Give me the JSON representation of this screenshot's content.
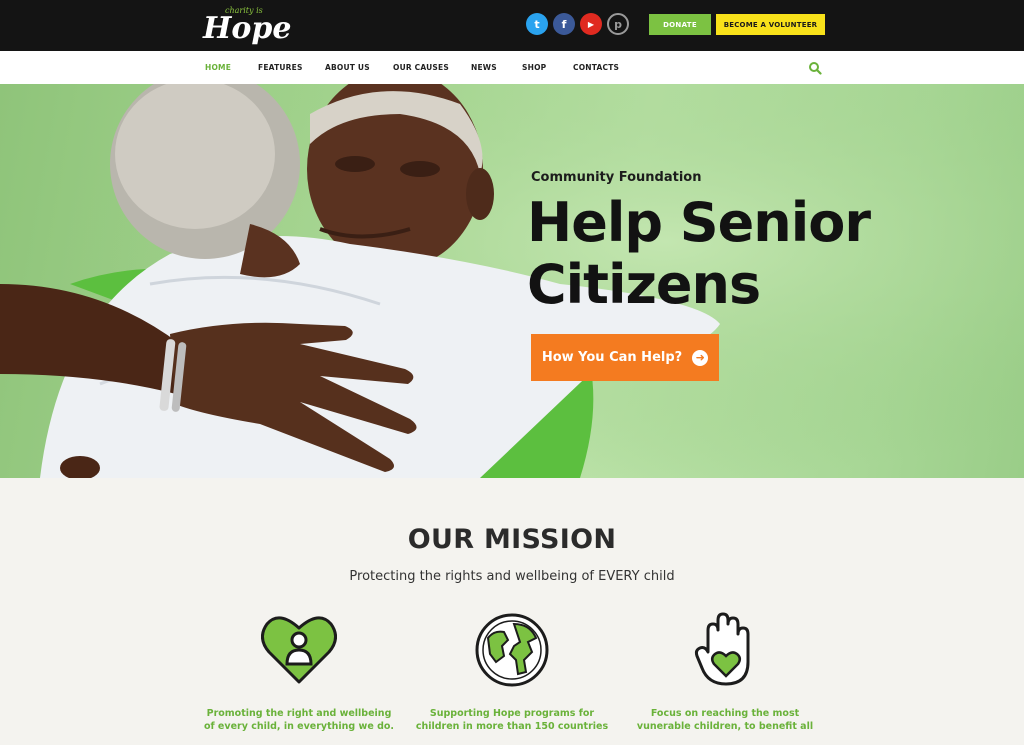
{
  "logo": {
    "tagline": "charity is",
    "word": "Hope"
  },
  "social": [
    {
      "icon": "twitter-icon",
      "glyph": "t"
    },
    {
      "icon": "facebook-icon",
      "glyph": "f"
    },
    {
      "icon": "youtube-icon",
      "glyph": "▶"
    },
    {
      "icon": "pinterest-icon",
      "glyph": "p"
    }
  ],
  "header": {
    "donate_label": "DONATE",
    "volunteer_label": "BECOME A VOLUNTEER"
  },
  "nav": {
    "items": [
      "HOME",
      "FEATURES",
      "ABOUT US",
      "OUR CAUSES",
      "NEWS",
      "SHOP",
      "CONTACTS"
    ],
    "active": "HOME"
  },
  "hero": {
    "eyebrow": "Community Foundation",
    "title_line1": "Help Senior",
    "title_line2": "Citizens",
    "cta_label": "How You Can Help?",
    "cta_icon": "arrow-right-icon"
  },
  "mission": {
    "title": "OUR MISSION",
    "subtitle": "Protecting the rights and wellbeing of EVERY child",
    "features": [
      {
        "icon": "heart-person-icon",
        "line1": "Promoting the right and wellbeing",
        "line2": "of every child, in everything we do."
      },
      {
        "icon": "globe-icon",
        "line1": "Supporting Hope programs for",
        "line2": "children in more than 150 countries"
      },
      {
        "icon": "hand-heart-icon",
        "line1": "Focus on reaching the most",
        "line2": "vunerable children, to benefit all"
      }
    ]
  },
  "colors": {
    "accent_green": "#7cc242",
    "accent_yellow": "#f8e11a",
    "cta_orange": "#f47b20",
    "dark_bar": "#141414"
  }
}
